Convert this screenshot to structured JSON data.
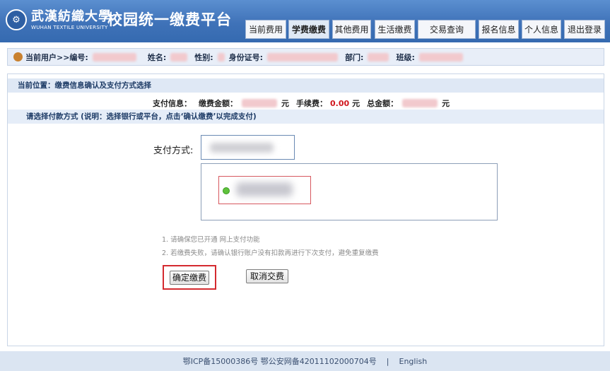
{
  "header": {
    "university_name_cn": "武漢紡織大學",
    "university_name_en": "WUHAN TEXTILE UNIVERSITY",
    "platform_title": "校园统一缴费平台"
  },
  "nav": {
    "items": [
      {
        "label": "当前费用"
      },
      {
        "label": "学费缴费"
      },
      {
        "label": "其他费用"
      },
      {
        "label": "生活缴费"
      },
      {
        "label": "交易查询"
      },
      {
        "label": "报名信息"
      },
      {
        "label": "个人信息"
      },
      {
        "label": "退出登录"
      }
    ]
  },
  "userbar": {
    "current_user_label": "当前用户>>编号:",
    "name_label": "姓名:",
    "gender_label": "性别:",
    "id_label": "身份证号:",
    "dept_label": "部门:",
    "class_label": "班级:"
  },
  "location": {
    "text": "当前位置：缴费信息确认及支付方式选择"
  },
  "payinfo": {
    "label": "支付信息：",
    "amount_label": "缴费金额：",
    "unit": "元",
    "fee_label": "手续费：",
    "fee_value": "0.00",
    "total_label": "总金额："
  },
  "hint": {
    "text": "请选择付款方式 (说明：选择银行或平台，点击‘确认缴费’以完成支付)"
  },
  "method": {
    "label": "支付方式:"
  },
  "notes": {
    "line1": "1. 请确保您已开通 网上支付功能",
    "line2": "2. 若缴费失败，请确认银行账户没有扣款再进行下次支付，避免重复缴费"
  },
  "buttons": {
    "confirm": "确定缴费",
    "cancel": "取消交费"
  },
  "footer": {
    "icp": "鄂ICP备15000386号 鄂公安网备42011102000704号",
    "separator": "|",
    "language": "English"
  }
}
